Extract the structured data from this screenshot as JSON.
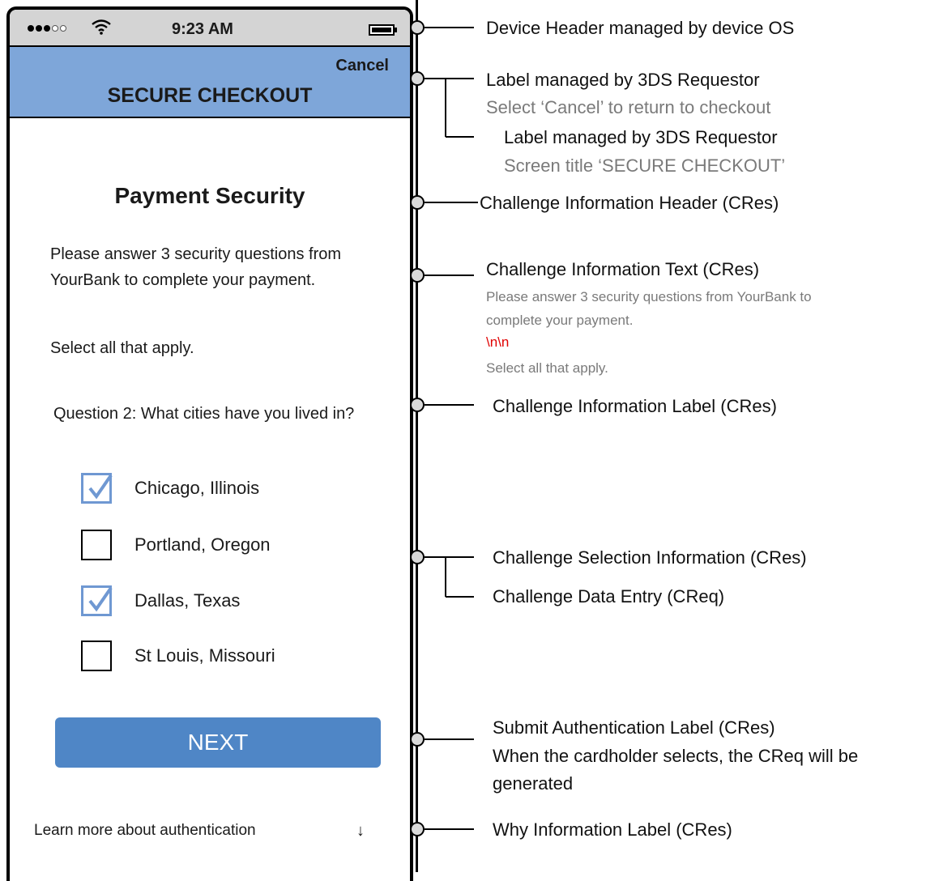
{
  "status_bar": {
    "time": "9:23 AM"
  },
  "nav": {
    "cancel_label": "Cancel",
    "title": "SECURE CHECKOUT"
  },
  "challenge": {
    "header": "Payment Security",
    "info_text": "Please answer 3 security questions from YourBank to complete your payment.",
    "select_all": "Select all that apply.",
    "question": "Question 2:  What cities have you lived in?",
    "options": [
      {
        "label": "Chicago, Illinois",
        "checked": true
      },
      {
        "label": "Portland, Oregon",
        "checked": false
      },
      {
        "label": "Dallas, Texas",
        "checked": true
      },
      {
        "label": "St Louis, Missouri",
        "checked": false
      }
    ],
    "submit_label": "NEXT",
    "why_label": "Learn more about authentication",
    "why_arrow": "↓"
  },
  "annotations": {
    "device_header": "Device Header managed by device OS",
    "cancel_label_title": "Label managed by 3DS Requestor",
    "cancel_label_sub": "Select ‘Cancel’ to return to checkout",
    "screen_title_title": "Label managed by 3DS Requestor",
    "screen_title_sub": "Screen title  ‘SECURE CHECKOUT’",
    "info_header": "Challenge Information Header (CRes)",
    "info_text_title": "Challenge Information Text (CRes)",
    "info_text_line1": "Please answer 3 security questions from YourBank to",
    "info_text_line2": "complete your payment.",
    "info_text_newline": "\\n\\n",
    "info_text_line3": "Select all that apply.",
    "info_label": "Challenge Information Label (CRes)",
    "selection_info": "Challenge Selection Information (CRes)",
    "data_entry": "Challenge Data Entry (CReq)",
    "submit_title": "Submit Authentication Label (CRes)",
    "submit_line2": "When the cardholder selects, the CReq will be",
    "submit_line3": "generated",
    "why_label": "Why Information Label (CRes)"
  }
}
